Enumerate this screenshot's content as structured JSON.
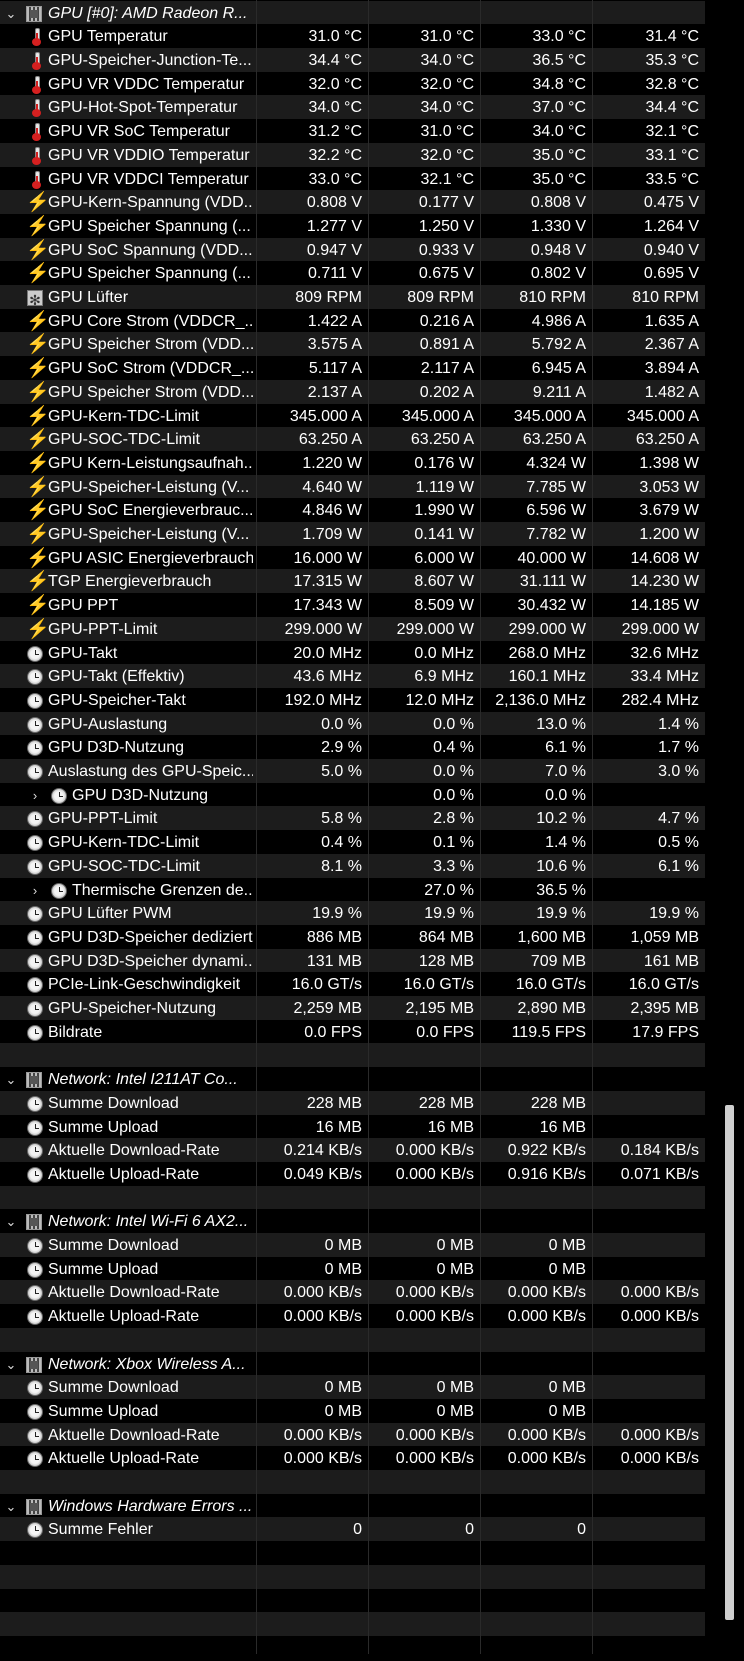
{
  "groups": [
    {
      "title": "GPU [#0]: AMD Radeon R...",
      "icon": "chip-icon",
      "rows": [
        {
          "label": "GPU Temperatur",
          "icon": "thermometer-icon",
          "v": [
            "31.0 °C",
            "31.0 °C",
            "33.0 °C",
            "31.4 °C"
          ]
        },
        {
          "label": "GPU-Speicher-Junction-Te...",
          "icon": "thermometer-icon",
          "v": [
            "34.4 °C",
            "34.0 °C",
            "36.5 °C",
            "35.3 °C"
          ]
        },
        {
          "label": "GPU VR VDDC Temperatur",
          "icon": "thermometer-icon",
          "v": [
            "32.0 °C",
            "32.0 °C",
            "34.8 °C",
            "32.8 °C"
          ]
        },
        {
          "label": "GPU-Hot-Spot-Temperatur",
          "icon": "thermometer-icon",
          "v": [
            "34.0 °C",
            "34.0 °C",
            "37.0 °C",
            "34.4 °C"
          ]
        },
        {
          "label": "GPU VR SoC Temperatur",
          "icon": "thermometer-icon",
          "v": [
            "31.2 °C",
            "31.0 °C",
            "34.0 °C",
            "32.1 °C"
          ]
        },
        {
          "label": "GPU VR VDDIO Temperatur",
          "icon": "thermometer-icon",
          "v": [
            "32.2 °C",
            "32.0 °C",
            "35.0 °C",
            "33.1 °C"
          ]
        },
        {
          "label": "GPU VR VDDCI Temperatur",
          "icon": "thermometer-icon",
          "v": [
            "33.0 °C",
            "32.1 °C",
            "35.0 °C",
            "33.5 °C"
          ]
        },
        {
          "label": "GPU-Kern-Spannung (VDD...",
          "icon": "bolt-icon",
          "v": [
            "0.808 V",
            "0.177 V",
            "0.808 V",
            "0.475 V"
          ]
        },
        {
          "label": "GPU Speicher Spannung (...",
          "icon": "bolt-icon",
          "v": [
            "1.277 V",
            "1.250 V",
            "1.330 V",
            "1.264 V"
          ]
        },
        {
          "label": "GPU SoC Spannung (VDD...",
          "icon": "bolt-icon",
          "v": [
            "0.947 V",
            "0.933 V",
            "0.948 V",
            "0.940 V"
          ]
        },
        {
          "label": "GPU Speicher Spannung (...",
          "icon": "bolt-icon",
          "v": [
            "0.711 V",
            "0.675 V",
            "0.802 V",
            "0.695 V"
          ]
        },
        {
          "label": "GPU Lüfter",
          "icon": "fan-icon",
          "v": [
            "809 RPM",
            "809 RPM",
            "810 RPM",
            "810 RPM"
          ]
        },
        {
          "label": "GPU Core Strom (VDDCR_...",
          "icon": "bolt-icon",
          "v": [
            "1.422 A",
            "0.216 A",
            "4.986 A",
            "1.635 A"
          ]
        },
        {
          "label": "GPU Speicher Strom (VDD...",
          "icon": "bolt-icon",
          "v": [
            "3.575 A",
            "0.891 A",
            "5.792 A",
            "2.367 A"
          ]
        },
        {
          "label": "GPU SoC Strom (VDDCR_...",
          "icon": "bolt-icon",
          "v": [
            "5.117 A",
            "2.117 A",
            "6.945 A",
            "3.894 A"
          ]
        },
        {
          "label": "GPU Speicher Strom (VDD...",
          "icon": "bolt-icon",
          "v": [
            "2.137 A",
            "0.202 A",
            "9.211 A",
            "1.482 A"
          ]
        },
        {
          "label": "GPU-Kern-TDC-Limit",
          "icon": "bolt-icon",
          "v": [
            "345.000 A",
            "345.000 A",
            "345.000 A",
            "345.000 A"
          ]
        },
        {
          "label": "GPU-SOC-TDC-Limit",
          "icon": "bolt-icon",
          "v": [
            "63.250 A",
            "63.250 A",
            "63.250 A",
            "63.250 A"
          ]
        },
        {
          "label": "GPU Kern-Leistungsaufnah...",
          "icon": "bolt-icon",
          "v": [
            "1.220 W",
            "0.176 W",
            "4.324 W",
            "1.398 W"
          ]
        },
        {
          "label": "GPU-Speicher-Leistung (V...",
          "icon": "bolt-icon",
          "v": [
            "4.640 W",
            "1.119 W",
            "7.785 W",
            "3.053 W"
          ]
        },
        {
          "label": "GPU SoC Energieverbrauc...",
          "icon": "bolt-icon",
          "v": [
            "4.846 W",
            "1.990 W",
            "6.596 W",
            "3.679 W"
          ]
        },
        {
          "label": "GPU-Speicher-Leistung (V...",
          "icon": "bolt-icon",
          "v": [
            "1.709 W",
            "0.141 W",
            "7.782 W",
            "1.200 W"
          ]
        },
        {
          "label": "GPU ASIC Energieverbrauch",
          "icon": "bolt-icon",
          "v": [
            "16.000 W",
            "6.000 W",
            "40.000 W",
            "14.608 W"
          ]
        },
        {
          "label": "TGP Energieverbrauch",
          "icon": "bolt-icon",
          "v": [
            "17.315 W",
            "8.607 W",
            "31.111 W",
            "14.230 W"
          ]
        },
        {
          "label": "GPU PPT",
          "icon": "bolt-icon",
          "v": [
            "17.343 W",
            "8.509 W",
            "30.432 W",
            "14.185 W"
          ]
        },
        {
          "label": "GPU-PPT-Limit",
          "icon": "bolt-icon",
          "v": [
            "299.000 W",
            "299.000 W",
            "299.000 W",
            "299.000 W"
          ]
        },
        {
          "label": "GPU-Takt",
          "icon": "clock-icon",
          "v": [
            "20.0 MHz",
            "0.0 MHz",
            "268.0 MHz",
            "32.6 MHz"
          ]
        },
        {
          "label": "GPU-Takt (Effektiv)",
          "icon": "clock-icon",
          "v": [
            "43.6 MHz",
            "6.9 MHz",
            "160.1 MHz",
            "33.4 MHz"
          ]
        },
        {
          "label": "GPU-Speicher-Takt",
          "icon": "clock-icon",
          "v": [
            "192.0 MHz",
            "12.0 MHz",
            "2,136.0 MHz",
            "282.4 MHz"
          ]
        },
        {
          "label": "GPU-Auslastung",
          "icon": "clock-icon",
          "v": [
            "0.0 %",
            "0.0 %",
            "13.0 %",
            "1.4 %"
          ]
        },
        {
          "label": "GPU D3D-Nutzung",
          "icon": "clock-icon",
          "v": [
            "2.9 %",
            "0.4 %",
            "6.1 %",
            "1.7 %"
          ]
        },
        {
          "label": "Auslastung des GPU-Speic...",
          "icon": "clock-icon",
          "v": [
            "5.0 %",
            "0.0 %",
            "7.0 %",
            "3.0 %"
          ]
        },
        {
          "label": "GPU D3D-Nutzung",
          "icon": "clock-icon",
          "sub": true,
          "v": [
            "",
            "0.0 %",
            "0.0 %",
            ""
          ]
        },
        {
          "label": "GPU-PPT-Limit",
          "icon": "clock-icon",
          "v": [
            "5.8 %",
            "2.8 %",
            "10.2 %",
            "4.7 %"
          ]
        },
        {
          "label": "GPU-Kern-TDC-Limit",
          "icon": "clock-icon",
          "v": [
            "0.4 %",
            "0.1 %",
            "1.4 %",
            "0.5 %"
          ]
        },
        {
          "label": "GPU-SOC-TDC-Limit",
          "icon": "clock-icon",
          "v": [
            "8.1 %",
            "3.3 %",
            "10.6 %",
            "6.1 %"
          ]
        },
        {
          "label": "Thermische Grenzen de...",
          "icon": "clock-icon",
          "sub": true,
          "v": [
            "",
            "27.0 %",
            "36.5 %",
            ""
          ]
        },
        {
          "label": "GPU Lüfter PWM",
          "icon": "clock-icon",
          "v": [
            "19.9 %",
            "19.9 %",
            "19.9 %",
            "19.9 %"
          ]
        },
        {
          "label": "GPU D3D-Speicher dediziert",
          "icon": "clock-icon",
          "v": [
            "886 MB",
            "864 MB",
            "1,600 MB",
            "1,059 MB"
          ]
        },
        {
          "label": "GPU D3D-Speicher dynami...",
          "icon": "clock-icon",
          "v": [
            "131 MB",
            "128 MB",
            "709 MB",
            "161 MB"
          ]
        },
        {
          "label": "PCIe-Link-Geschwindigkeit",
          "icon": "clock-icon",
          "v": [
            "16.0 GT/s",
            "16.0 GT/s",
            "16.0 GT/s",
            "16.0 GT/s"
          ]
        },
        {
          "label": "GPU-Speicher-Nutzung",
          "icon": "clock-icon",
          "v": [
            "2,259 MB",
            "2,195 MB",
            "2,890 MB",
            "2,395 MB"
          ]
        },
        {
          "label": "Bildrate",
          "icon": "clock-icon",
          "v": [
            "0.0 FPS",
            "0.0 FPS",
            "119.5 FPS",
            "17.9 FPS"
          ]
        }
      ]
    },
    {
      "title": "Network: Intel I211AT Co...",
      "icon": "chip-icon",
      "rows": [
        {
          "label": "Summe Download",
          "icon": "clock-icon",
          "v": [
            "228 MB",
            "228 MB",
            "228 MB",
            ""
          ]
        },
        {
          "label": "Summe Upload",
          "icon": "clock-icon",
          "v": [
            "16 MB",
            "16 MB",
            "16 MB",
            ""
          ]
        },
        {
          "label": "Aktuelle Download-Rate",
          "icon": "clock-icon",
          "v": [
            "0.214 KB/s",
            "0.000 KB/s",
            "0.922 KB/s",
            "0.184 KB/s"
          ]
        },
        {
          "label": "Aktuelle Upload-Rate",
          "icon": "clock-icon",
          "v": [
            "0.049 KB/s",
            "0.000 KB/s",
            "0.916 KB/s",
            "0.071 KB/s"
          ]
        }
      ]
    },
    {
      "title": "Network: Intel Wi-Fi 6 AX2...",
      "icon": "chip-icon",
      "rows": [
        {
          "label": "Summe Download",
          "icon": "clock-icon",
          "v": [
            "0 MB",
            "0 MB",
            "0 MB",
            ""
          ]
        },
        {
          "label": "Summe Upload",
          "icon": "clock-icon",
          "v": [
            "0 MB",
            "0 MB",
            "0 MB",
            ""
          ]
        },
        {
          "label": "Aktuelle Download-Rate",
          "icon": "clock-icon",
          "v": [
            "0.000 KB/s",
            "0.000 KB/s",
            "0.000 KB/s",
            "0.000 KB/s"
          ]
        },
        {
          "label": "Aktuelle Upload-Rate",
          "icon": "clock-icon",
          "v": [
            "0.000 KB/s",
            "0.000 KB/s",
            "0.000 KB/s",
            "0.000 KB/s"
          ]
        }
      ]
    },
    {
      "title": "Network: Xbox Wireless A...",
      "icon": "chip-icon",
      "rows": [
        {
          "label": "Summe Download",
          "icon": "clock-icon",
          "v": [
            "0 MB",
            "0 MB",
            "0 MB",
            ""
          ]
        },
        {
          "label": "Summe Upload",
          "icon": "clock-icon",
          "v": [
            "0 MB",
            "0 MB",
            "0 MB",
            ""
          ]
        },
        {
          "label": "Aktuelle Download-Rate",
          "icon": "clock-icon",
          "v": [
            "0.000 KB/s",
            "0.000 KB/s",
            "0.000 KB/s",
            "0.000 KB/s"
          ]
        },
        {
          "label": "Aktuelle Upload-Rate",
          "icon": "clock-icon",
          "v": [
            "0.000 KB/s",
            "0.000 KB/s",
            "0.000 KB/s",
            "0.000 KB/s"
          ]
        }
      ]
    },
    {
      "title": "Windows Hardware Errors ...",
      "icon": "chip-icon",
      "rows": [
        {
          "label": "Summe Fehler",
          "icon": "clock-icon",
          "v": [
            "0",
            "0",
            "0",
            ""
          ]
        }
      ]
    }
  ],
  "colors": {
    "row_alt": "#1c1c1c",
    "background": "#000000",
    "text": "#ffffff",
    "bolt": "#ffc40a",
    "thermo": "#d52020"
  },
  "scrollbar": {
    "icon": "scrollbar-thumb"
  }
}
